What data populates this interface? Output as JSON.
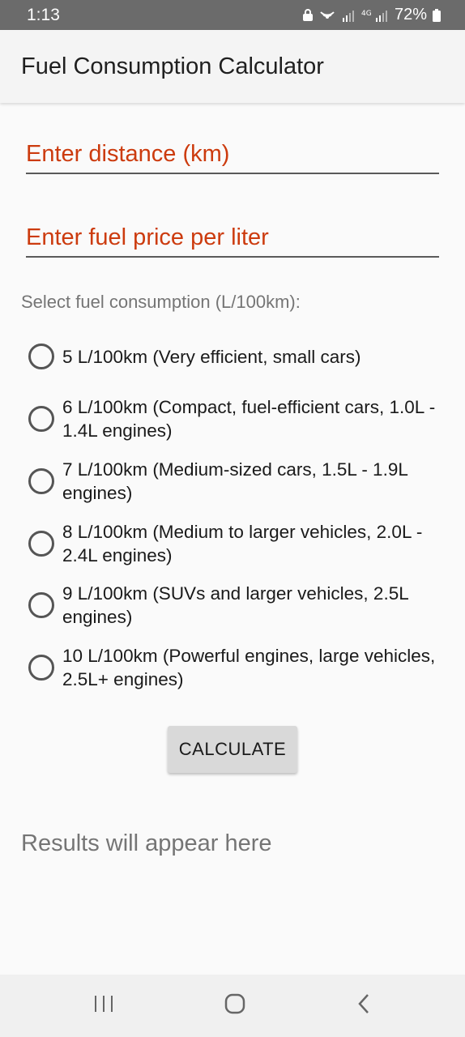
{
  "status_bar": {
    "time": "1:13",
    "battery": "72%",
    "network": "4G"
  },
  "app_bar": {
    "title": "Fuel Consumption Calculator"
  },
  "inputs": {
    "distance_placeholder": "Enter distance (km)",
    "price_placeholder": "Enter fuel price per liter",
    "distance_value": "",
    "price_value": ""
  },
  "consumption": {
    "label": "Select fuel consumption (L/100km):",
    "options": [
      "5 L/100km (Very efficient, small cars)",
      "6 L/100km (Compact, fuel-efficient cars, 1.0L - 1.4L engines)",
      "7 L/100km (Medium-sized cars, 1.5L - 1.9L engines)",
      "8 L/100km (Medium to larger vehicles, 2.0L - 2.4L engines)",
      "9 L/100km (SUVs and larger vehicles, 2.5L engines)",
      "10 L/100km (Powerful engines, large vehicles, 2.5L+ engines)"
    ]
  },
  "actions": {
    "calculate_label": "CALCULATE"
  },
  "results": {
    "text": "Results will appear here"
  },
  "colors": {
    "placeholder_accent": "#cc3b0e",
    "status_bar": "#6b6b6b"
  },
  "icons": {
    "status": [
      "lock-icon",
      "hotspot-icon",
      "signal-r-icon",
      "signal-4g-icon",
      "battery-icon"
    ],
    "nav": [
      "recents-icon",
      "home-icon",
      "back-icon"
    ]
  }
}
